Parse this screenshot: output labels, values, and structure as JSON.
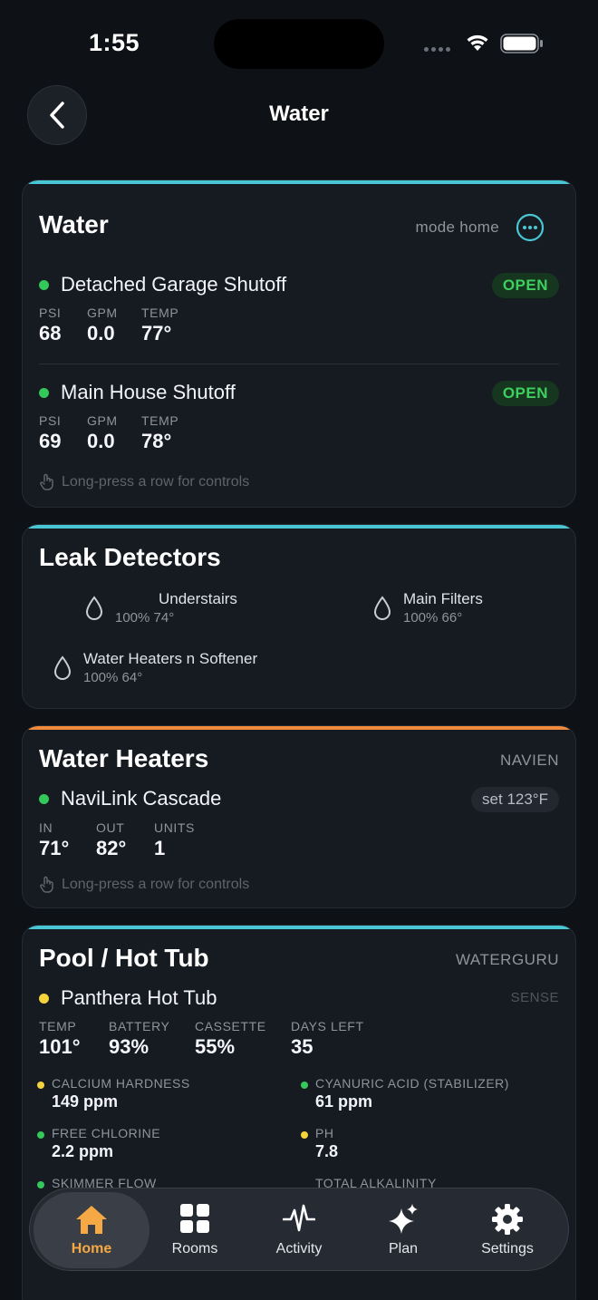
{
  "status": {
    "time": "1:55"
  },
  "nav": {
    "title": "Water"
  },
  "water_card": {
    "title": "Water",
    "mode": "mode home",
    "rows": [
      {
        "name": "Detached Garage Shutoff",
        "status": "OPEN",
        "stats": [
          {
            "label": "PSI",
            "value": "68"
          },
          {
            "label": "GPM",
            "value": "0.0"
          },
          {
            "label": "TEMP",
            "value": "77°"
          }
        ]
      },
      {
        "name": "Main House Shutoff",
        "status": "OPEN",
        "stats": [
          {
            "label": "PSI",
            "value": "69"
          },
          {
            "label": "GPM",
            "value": "0.0"
          },
          {
            "label": "TEMP",
            "value": "78°"
          }
        ]
      }
    ],
    "hint": "Long-press a row for controls"
  },
  "leak_card": {
    "title": "Leak Detectors",
    "items": [
      {
        "name": "Understairs",
        "detail": "100%  74°"
      },
      {
        "name": "Main Filters",
        "detail": "100%  66°"
      },
      {
        "name": "Water Heaters n Softener",
        "detail": "100%  64°"
      }
    ]
  },
  "heater_card": {
    "title": "Water Heaters",
    "brand": "NAVIEN",
    "name": "NaviLink Cascade",
    "setpoint": "set 123°F",
    "stats": [
      {
        "label": "IN",
        "value": "71°"
      },
      {
        "label": "OUT",
        "value": "82°"
      },
      {
        "label": "UNITS",
        "value": "1"
      }
    ],
    "hint": "Long-press a row for controls"
  },
  "pool_card": {
    "title": "Pool / Hot Tub",
    "brand": "WATERGURU",
    "name": "Panthera Hot Tub",
    "source": "SENSE",
    "stats": [
      {
        "label": "TEMP",
        "value": "101°"
      },
      {
        "label": "BATTERY",
        "value": "93%"
      },
      {
        "label": "CASSETTE",
        "value": "55%"
      },
      {
        "label": "DAYS LEFT",
        "value": "35"
      }
    ],
    "chems": [
      {
        "label": "CALCIUM HARDNESS",
        "value": "149 ppm",
        "status": "yellow"
      },
      {
        "label": "CYANURIC ACID (STABILIZER)",
        "value": "61 ppm",
        "status": "green"
      },
      {
        "label": "FREE CHLORINE",
        "value": "2.2 ppm",
        "status": "green"
      },
      {
        "label": "PH",
        "value": "7.8",
        "status": "yellow"
      },
      {
        "label": "SKIMMER FLOW",
        "value": "",
        "status": "green"
      },
      {
        "label": "TOTAL ALKALINITY",
        "value": "",
        "status": "green"
      }
    ]
  },
  "tabs": [
    {
      "label": "Home",
      "icon": "house-icon",
      "active": true
    },
    {
      "label": "Rooms",
      "icon": "grid-icon"
    },
    {
      "label": "Activity",
      "icon": "pulse-icon"
    },
    {
      "label": "Plan",
      "icon": "sparkle-icon"
    },
    {
      "label": "Settings",
      "icon": "gear-icon"
    }
  ],
  "colors": {
    "accent_teal": "#49c6d3",
    "accent_orange": "#f08a3c",
    "tab_active": "#f5a843"
  }
}
